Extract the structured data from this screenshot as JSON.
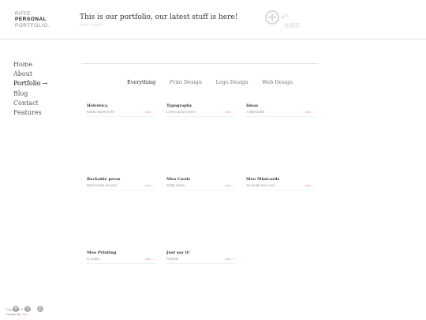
{
  "logo": {
    "line1": "RIFFE",
    "line2": "PERSONAL",
    "line3": "PORTFOLIO."
  },
  "header": {
    "tagline": "This is our portfolio, our latest stuff is here!",
    "subtag": "hello, elegant",
    "hire_label": "HIRE",
    "hire_arrow": "↶"
  },
  "nav": {
    "items": [
      {
        "label": "Home"
      },
      {
        "label": "About"
      },
      {
        "label": "Portfolio",
        "arrow": "→"
      },
      {
        "label": "Blog"
      },
      {
        "label": "Contact"
      },
      {
        "label": "Features"
      }
    ]
  },
  "filter": {
    "items": [
      "Everything",
      "Print Design",
      "Logo Design",
      "Web Design"
    ],
    "active": "Everything"
  },
  "portfolio": {
    "items": [
      {
        "title": "Helvetica",
        "desc": "Kinda sweet huh?",
        "view": "view →"
      },
      {
        "title": "Typography",
        "desc": "Lorem ipsum here.",
        "view": "view →"
      },
      {
        "title": "Ideas",
        "desc": "A light bulb!",
        "view": "view →"
      },
      {
        "title": "Rockable press",
        "desc": "Best books around.",
        "view": "view →"
      },
      {
        "title": "Moo Cards",
        "desc": "Gotta been!..",
        "view": "view →"
      },
      {
        "title": "Moo Minicards",
        "desc": "So small and cool.",
        "view": "view →"
      },
      {
        "title": "Moo Printing",
        "desc": "Is made.",
        "view": "view →"
      },
      {
        "title": "Just say it!",
        "desc": "Printed.",
        "view": "view →"
      }
    ]
  },
  "footer": {
    "social": [
      {
        "icon": "facebook-icon",
        "glyph": "f"
      },
      {
        "icon": "twitter-icon",
        "glyph": "t"
      },
      {
        "icon": "rss-icon",
        "glyph": "r"
      }
    ],
    "copyright": "Copyright © 2012",
    "design_prefix": "Design By",
    "design_link": "Owl"
  },
  "colors": {
    "accent": "#f08aa8",
    "text": "#333333",
    "muted": "#999999"
  }
}
